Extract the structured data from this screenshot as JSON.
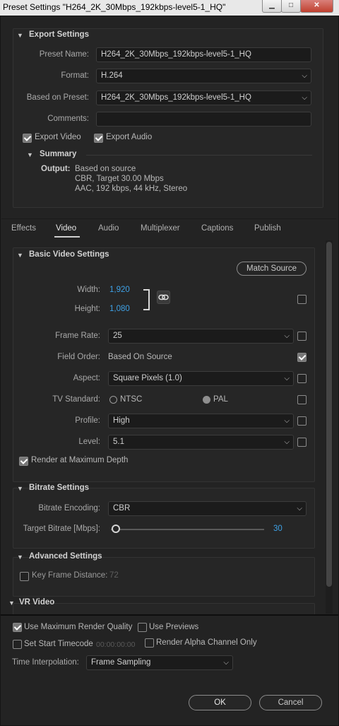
{
  "window": {
    "title": "Preset Settings \"H264_2K_30Mbps_192kbps-level5-1_HQ\"",
    "minimize_glyph": "▁",
    "maximize_glyph": "□",
    "close_glyph": "✕"
  },
  "export_settings": {
    "header": "Export Settings",
    "preset_name_label": "Preset Name:",
    "preset_name_value": "H264_2K_30Mbps_192kbps-level5-1_HQ",
    "format_label": "Format:",
    "format_value": "H.264",
    "based_on_label": "Based on Preset:",
    "based_on_value": "H264_2K_30Mbps_192kbps-level5-1_HQ",
    "comments_label": "Comments:",
    "comments_value": "",
    "export_video_label": "Export Video",
    "export_video_checked": true,
    "export_audio_label": "Export Audio",
    "export_audio_checked": true,
    "summary_header": "Summary",
    "output_label": "Output:",
    "output_lines": [
      "Based on source",
      "CBR, Target 30.00 Mbps",
      "AAC, 192 kbps, 44 kHz, Stereo"
    ]
  },
  "tabs": [
    "Effects",
    "Video",
    "Audio",
    "Multiplexer",
    "Captions",
    "Publish"
  ],
  "active_tab": "Video",
  "basic_video": {
    "header": "Basic Video Settings",
    "match_source": "Match Source",
    "width_label": "Width:",
    "width_value": "1,920",
    "height_label": "Height:",
    "height_value": "1,080",
    "frame_rate_label": "Frame Rate:",
    "frame_rate_value": "25",
    "field_order_label": "Field Order:",
    "field_order_value": "Based On Source",
    "aspect_label": "Aspect:",
    "aspect_value": "Square Pixels (1.0)",
    "tv_standard_label": "TV Standard:",
    "ntsc_label": "NTSC",
    "pal_label": "PAL",
    "profile_label": "Profile:",
    "profile_value": "High",
    "level_label": "Level:",
    "level_value": "5.1",
    "render_max_depth_label": "Render at Maximum Depth",
    "render_max_depth_checked": true
  },
  "bitrate": {
    "header": "Bitrate Settings",
    "encoding_label": "Bitrate Encoding:",
    "encoding_value": "CBR",
    "target_label": "Target Bitrate [Mbps]:",
    "target_value": "30",
    "slider_fraction": 0.03
  },
  "advanced": {
    "header": "Advanced Settings",
    "key_frame_label": "Key Frame Distance:",
    "key_frame_value": "72"
  },
  "vr": {
    "header": "VR Video"
  },
  "footer": {
    "max_render_quality_label": "Use Maximum Render Quality",
    "max_render_quality_checked": true,
    "use_previews_label": "Use Previews",
    "set_start_timecode_label": "Set Start Timecode",
    "start_timecode_value": "00:00:00:00",
    "render_alpha_label": "Render Alpha Channel Only",
    "time_interp_label": "Time Interpolation:",
    "time_interp_value": "Frame Sampling",
    "ok": "OK",
    "cancel": "Cancel"
  },
  "colors": {
    "accent_value": "#3ea1e6",
    "background": "#232323"
  }
}
